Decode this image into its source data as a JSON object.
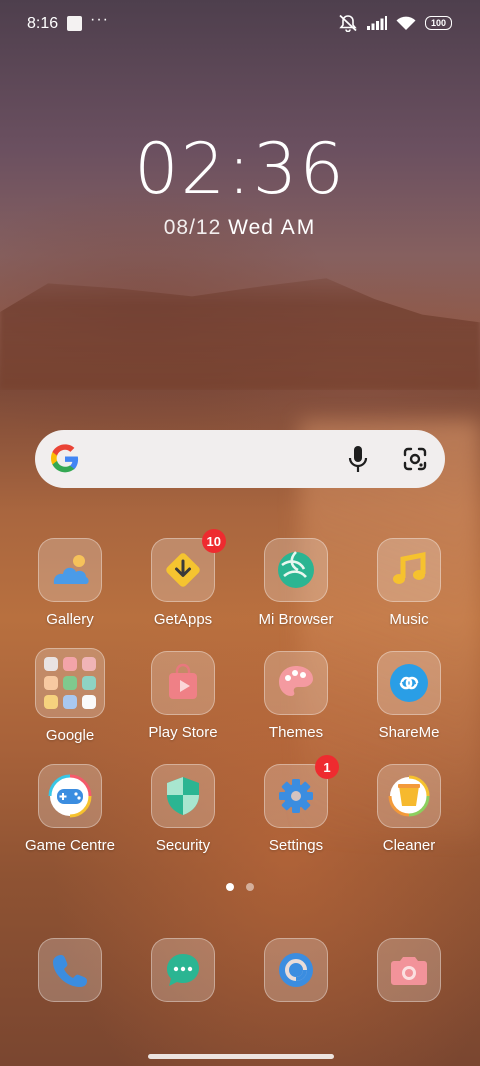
{
  "status_bar": {
    "time": "8:16",
    "overflow": "···",
    "battery": "100",
    "icons": [
      "silent-icon",
      "signal-icon",
      "wifi-icon",
      "battery-icon"
    ]
  },
  "lockclock": {
    "time": "02:36",
    "date": "08/12",
    "day": "Wed",
    "meridiem": "AM"
  },
  "search": {
    "icons": [
      "google-logo-icon",
      "microphone-icon",
      "google-lens-icon"
    ]
  },
  "apps": [
    {
      "label": "Gallery",
      "icon": "gallery-icon"
    },
    {
      "label": "GetApps",
      "icon": "getapps-icon",
      "badge": "10"
    },
    {
      "label": "Mi Browser",
      "icon": "mi-browser-icon"
    },
    {
      "label": "Music",
      "icon": "music-icon"
    },
    {
      "label": "Google",
      "icon": "google-folder-icon"
    },
    {
      "label": "Play Store",
      "icon": "play-store-icon"
    },
    {
      "label": "Themes",
      "icon": "themes-icon"
    },
    {
      "label": "ShareMe",
      "icon": "shareme-icon"
    },
    {
      "label": "Game Centre",
      "icon": "game-centre-icon"
    },
    {
      "label": "Security",
      "icon": "security-icon"
    },
    {
      "label": "Settings",
      "icon": "settings-icon",
      "badge": "1"
    },
    {
      "label": "Cleaner",
      "icon": "cleaner-icon"
    }
  ],
  "dock": [
    {
      "icon": "phone-icon"
    },
    {
      "icon": "messages-icon"
    },
    {
      "icon": "browser-icon"
    },
    {
      "icon": "camera-icon"
    }
  ],
  "pager": {
    "pages": 2,
    "active": 1
  },
  "colors": {
    "badge": "#ee2b2f",
    "search_bg": "#f1eeee",
    "accent_blue": "#3b8de0"
  }
}
